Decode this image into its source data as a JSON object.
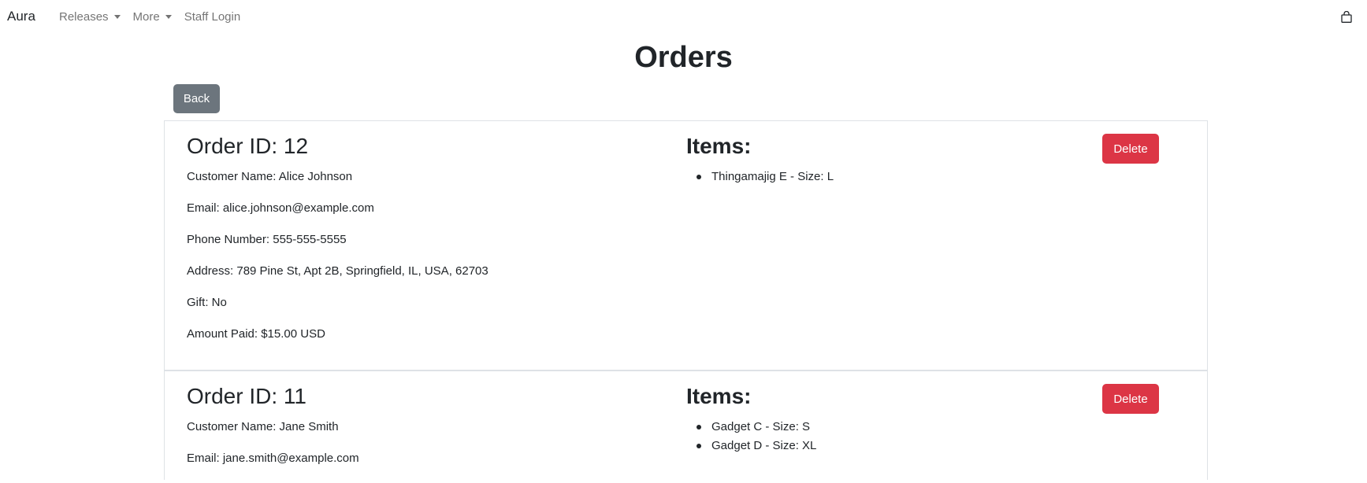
{
  "nav": {
    "brand": "Aura",
    "links": [
      {
        "label": "Releases",
        "dropdown": true
      },
      {
        "label": "More",
        "dropdown": true
      },
      {
        "label": "Staff Login",
        "dropdown": false
      }
    ],
    "cart_icon": "shopping-bag-icon"
  },
  "page": {
    "title": "Orders",
    "back_label": "Back"
  },
  "colors": {
    "back_button": "#6c757d",
    "delete_button": "#dc3545",
    "border": "#dee2e6"
  },
  "orders": [
    {
      "id_label": "Order ID: 12",
      "customer": "Customer Name: Alice Johnson",
      "email": "Email: alice.johnson@example.com",
      "phone": "Phone Number: 555-555-5555",
      "address": "Address: 789 Pine St, Apt 2B, Springfield, IL, USA, 62703",
      "gift": "Gift: No",
      "amount": "Amount Paid: $15.00 USD",
      "items_heading": "Items:",
      "items": [
        "Thingamajig E - Size: L"
      ],
      "delete_label": "Delete"
    },
    {
      "id_label": "Order ID: 11",
      "customer": "Customer Name: Jane Smith",
      "email": "Email: jane.smith@example.com",
      "items_heading": "Items:",
      "items": [
        "Gadget C - Size: S",
        "Gadget D - Size: XL"
      ],
      "delete_label": "Delete"
    }
  ]
}
